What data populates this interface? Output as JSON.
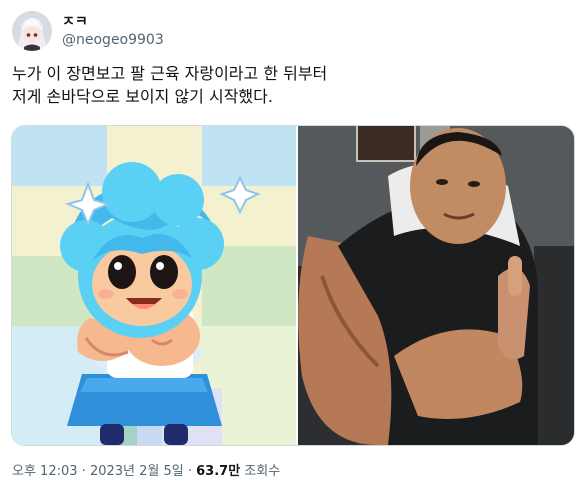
{
  "user": {
    "display_name": "ㅈㅋ",
    "handle": "@neogeo9903"
  },
  "tweet": {
    "lines": [
      "누가 이 장면보고 팔 근육 자랑이라고 한 뒤부터",
      "저게 손바닥으로 보이지 않기 시작했다."
    ]
  },
  "media": {
    "left_image": "cartoon-girl-flexing-arm",
    "right_image": "muscular-man-flexing-arm"
  },
  "meta": {
    "time": "오후 12:03",
    "sep1": " · ",
    "date": "2023년 2월 5일",
    "sep2": " · ",
    "views": "63.7만",
    "views_label": " 조회수"
  },
  "colors": {
    "text": "#0f1419",
    "secondary": "#536471",
    "border": "#cfd9de"
  }
}
